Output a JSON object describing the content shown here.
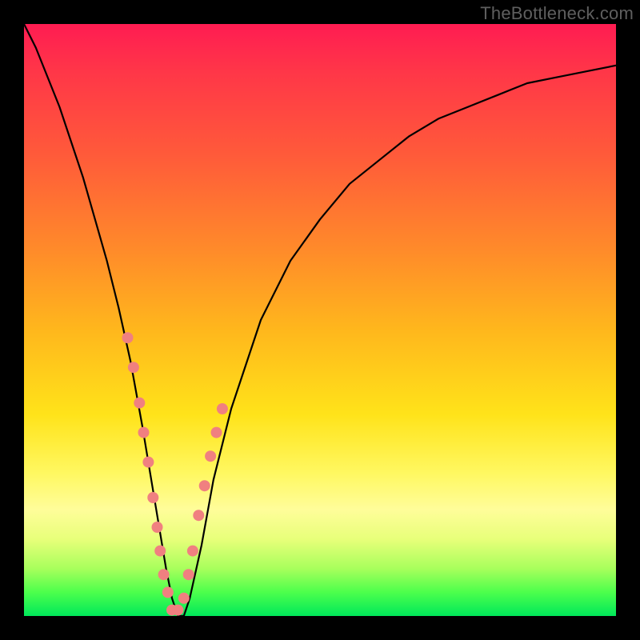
{
  "watermark": "TheBottleneck.com",
  "chart_data": {
    "type": "line",
    "title": "",
    "xlabel": "",
    "ylabel": "",
    "xlim": [
      0,
      100
    ],
    "ylim": [
      0,
      100
    ],
    "series": [
      {
        "name": "bottleneck-curve",
        "x": [
          0,
          2,
          4,
          6,
          8,
          10,
          12,
          14,
          16,
          18,
          20,
          22,
          24,
          25,
          26,
          27,
          28,
          30,
          32,
          35,
          40,
          45,
          50,
          55,
          60,
          65,
          70,
          75,
          80,
          85,
          90,
          95,
          100
        ],
        "values": [
          100,
          96,
          91,
          86,
          80,
          74,
          67,
          60,
          52,
          43,
          32,
          20,
          8,
          3,
          0,
          0,
          3,
          12,
          23,
          35,
          50,
          60,
          67,
          73,
          77,
          81,
          84,
          86,
          88,
          90,
          91,
          92,
          93
        ]
      }
    ],
    "markers": {
      "name": "highlighted-points",
      "color": "#f08080",
      "x": [
        17.5,
        18.5,
        19.5,
        20.2,
        21.0,
        21.8,
        22.5,
        23.0,
        23.6,
        24.3,
        25.0,
        26.0,
        27.0,
        27.8,
        28.5,
        29.5,
        30.5,
        31.5,
        32.5,
        33.5
      ],
      "values": [
        47,
        42,
        36,
        31,
        26,
        20,
        15,
        11,
        7,
        4,
        1,
        1,
        3,
        7,
        11,
        17,
        22,
        27,
        31,
        35
      ]
    }
  }
}
